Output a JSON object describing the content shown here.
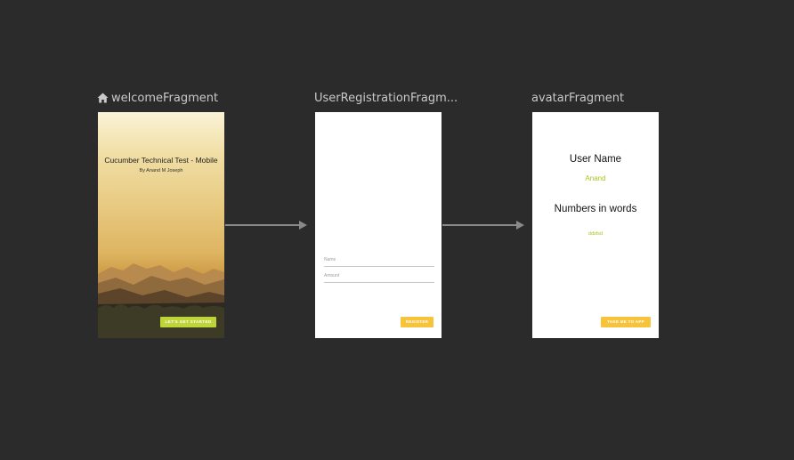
{
  "fragments": [
    {
      "label": "welcomeFragment",
      "is_start": true,
      "title": "Cucumber Technical Test - Mobile",
      "subtitle": "By Anand M Joseph",
      "button": "LET'S GET STARTED"
    },
    {
      "label": "UserRegistrationFragm...",
      "fields": [
        {
          "placeholder": "Name"
        },
        {
          "placeholder": "Amount"
        }
      ],
      "button": "REGISTER"
    },
    {
      "label": "avatarFragment",
      "user_name_label": "User Name",
      "user_name_value": "Anand",
      "numbers_label": "Numbers in words",
      "numbers_value": "ddsfsd",
      "button": "TAKE ME TO APP"
    }
  ],
  "icons": {
    "start_destination": "home-icon"
  },
  "colors": {
    "canvas_bg": "#2b2b2c",
    "arrow": "#8a8a8a",
    "green_button": "#bfd438",
    "amber_button": "#f6c33b",
    "green_text": "#a7c41a"
  }
}
